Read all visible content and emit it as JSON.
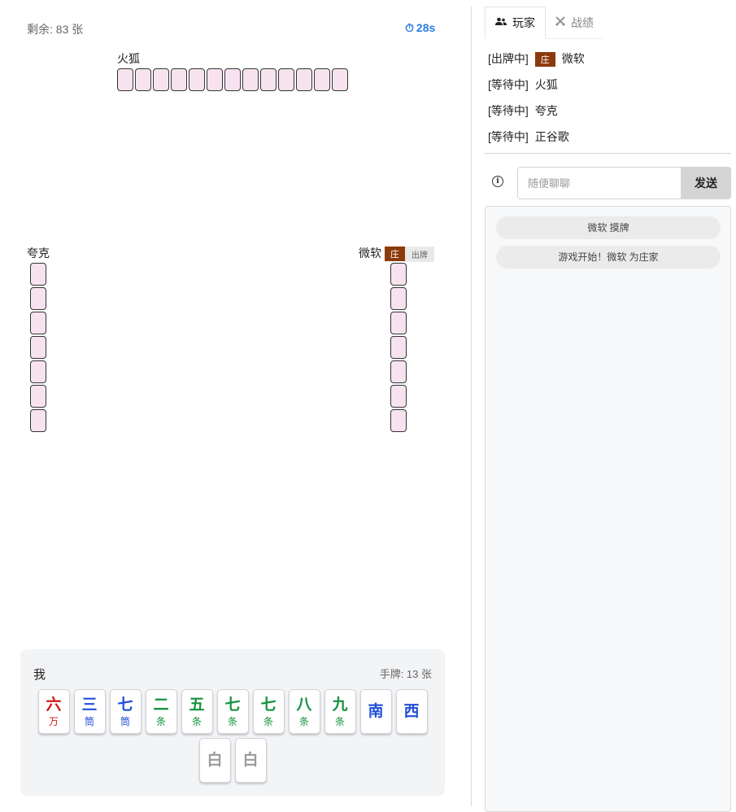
{
  "game": {
    "remaining": "剩余: 83 张",
    "timer": "28s",
    "timer_icon": "stopwatch-icon"
  },
  "players": {
    "top": {
      "name": "火狐",
      "tile_count": 13
    },
    "left": {
      "name": "夸克",
      "tile_count": 7
    },
    "right": {
      "name": "微软",
      "dealer_badge": "庄",
      "action_label": "出牌",
      "tile_count": 7
    }
  },
  "hand": {
    "owner": "我",
    "count_label": "手牌: 13 张",
    "tiles_row1": [
      {
        "rank": "六",
        "suit": "万",
        "color": "red"
      },
      {
        "rank": "三",
        "suit": "筒",
        "color": "blue"
      },
      {
        "rank": "七",
        "suit": "筒",
        "color": "blue"
      },
      {
        "rank": "二",
        "suit": "条",
        "color": "green"
      },
      {
        "rank": "五",
        "suit": "条",
        "color": "green"
      },
      {
        "rank": "七",
        "suit": "条",
        "color": "green"
      },
      {
        "rank": "七",
        "suit": "条",
        "color": "green"
      },
      {
        "rank": "八",
        "suit": "条",
        "color": "green"
      },
      {
        "rank": "九",
        "suit": "条",
        "color": "green"
      },
      {
        "rank": "南",
        "suit": "",
        "color": "blue"
      },
      {
        "rank": "西",
        "suit": "",
        "color": "blue"
      }
    ],
    "tiles_row2": [
      {
        "rank": "白",
        "suit": "",
        "color": "gray"
      },
      {
        "rank": "白",
        "suit": "",
        "color": "gray"
      }
    ]
  },
  "colors": {
    "red": "#d11a1a",
    "blue": "#1f4fd6",
    "green": "#15933f",
    "gray": "#9a9a9a",
    "dealer": "#8b3a0b",
    "accent": "#2f7de1"
  },
  "sidebar": {
    "tabs": [
      {
        "label": "玩家",
        "icon": "users-icon",
        "active": true
      },
      {
        "label": "战绩",
        "icon": "swords-icon",
        "active": false
      }
    ],
    "player_list": [
      {
        "status": "[出牌中]",
        "dealer_badge": "庄",
        "name": "微软"
      },
      {
        "status": "[等待中]",
        "dealer_badge": "",
        "name": "火狐"
      },
      {
        "status": "[等待中]",
        "dealer_badge": "",
        "name": "夸克"
      },
      {
        "status": "[等待中]",
        "dealer_badge": "",
        "name": "正谷歌"
      }
    ],
    "chat": {
      "placeholder": "随便聊聊",
      "send_label": "发送",
      "info_icon": "info-icon"
    },
    "log": [
      "微软 摸牌",
      "游戏开始！微软 为庄家"
    ]
  }
}
